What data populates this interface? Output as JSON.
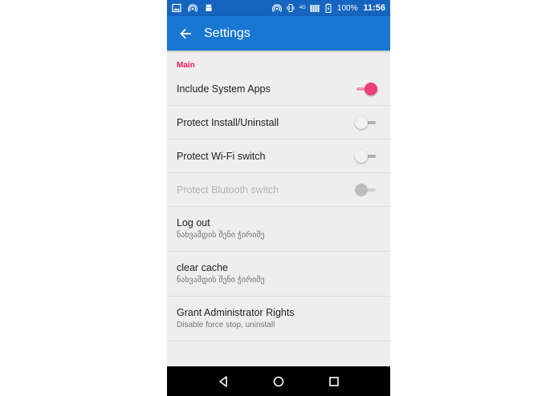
{
  "status_bar": {
    "battery_percent": "100%",
    "time": "11:56",
    "network_label": "4G",
    "left_icons": [
      "image-icon",
      "hotspot-icon",
      "android-icon"
    ],
    "right_icons": [
      "hotspot-icon",
      "vibrate-icon",
      "signal-icon",
      "battery-icon"
    ]
  },
  "toolbar": {
    "title": "Settings",
    "back_icon": "arrow-back-icon",
    "color": "#1976d2",
    "status_color": "#1565c0"
  },
  "section": {
    "header": "Main",
    "accent_color": "#e91e63"
  },
  "prefs": [
    {
      "title": "Include System Apps",
      "switch": "on"
    },
    {
      "title": "Protect Install/Uninstall",
      "switch": "off"
    },
    {
      "title": "Protect Wi-Fi switch",
      "switch": "off"
    },
    {
      "title": "Protect Blutooth switch",
      "switch": "disabled"
    },
    {
      "title": "Log out",
      "summary": "ნახვამდის შენი ჭირიმე"
    },
    {
      "title": "clear cache",
      "summary": "ნახვამდის შენი ჭირიმე"
    },
    {
      "title": "Grant Administrator Rights",
      "summary": "Disable force stop, uninstall"
    }
  ],
  "nav_bar": {
    "buttons": [
      "back-triangle-icon",
      "home-circle-icon",
      "recents-square-icon"
    ]
  }
}
